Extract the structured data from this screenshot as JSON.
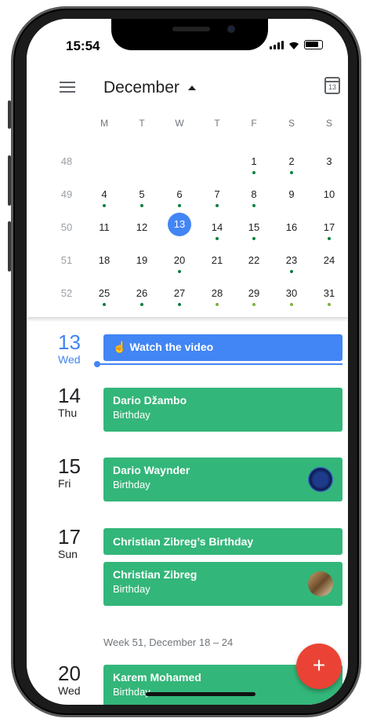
{
  "status": {
    "time": "15:54"
  },
  "header": {
    "month": "December",
    "cal_icon_day": "13"
  },
  "calendar": {
    "dow": [
      "M",
      "T",
      "W",
      "T",
      "F",
      "S",
      "S"
    ],
    "weeks": [
      {
        "wk": "48",
        "days": [
          "",
          "",
          "",
          "",
          "1",
          "2",
          "3"
        ],
        "dots": [
          "",
          "",
          "",
          "",
          "teal",
          "teal",
          ""
        ]
      },
      {
        "wk": "49",
        "days": [
          "4",
          "5",
          "6",
          "7",
          "8",
          "9",
          "10"
        ],
        "dots": [
          "teal",
          "teal",
          "teal",
          "teal",
          "teal",
          "",
          ""
        ]
      },
      {
        "wk": "50",
        "days": [
          "11",
          "12",
          "13",
          "14",
          "15",
          "16",
          "17"
        ],
        "dots": [
          "",
          "",
          "",
          "teal",
          "teal",
          "",
          "teal"
        ]
      },
      {
        "wk": "51",
        "days": [
          "18",
          "19",
          "20",
          "21",
          "22",
          "23",
          "24"
        ],
        "dots": [
          "",
          "",
          "teal",
          "",
          "",
          "teal",
          ""
        ]
      },
      {
        "wk": "52",
        "days": [
          "25",
          "26",
          "27",
          "28",
          "29",
          "30",
          "31"
        ],
        "dots": [
          "teal",
          "teal",
          "teal",
          "green",
          "green",
          "green",
          "green"
        ]
      }
    ],
    "today": "13"
  },
  "agenda": {
    "days": [
      {
        "num": "13",
        "name": "Wed"
      },
      {
        "num": "14",
        "name": "Thu"
      },
      {
        "num": "15",
        "name": "Fri"
      },
      {
        "num": "17",
        "name": "Sun"
      },
      {
        "num": "20",
        "name": "Wed"
      }
    ],
    "events": [
      {
        "title": "Watch the video"
      },
      {
        "title": "Dario Džambo",
        "sub": "Birthday"
      },
      {
        "title": "Dario Waynder",
        "sub": "Birthday"
      },
      {
        "title": "Christian Zibreg’s Birthday"
      },
      {
        "title": "Christian Zibreg",
        "sub": "Birthday"
      },
      {
        "title": "Karem Mohamed",
        "sub": "Birthday"
      }
    ],
    "week_header": "Week 51, December 18 – 24"
  },
  "fab": {
    "label": "+"
  },
  "colors": {
    "blue": "#4285f4",
    "green": "#33b679",
    "teal": "#0b8043",
    "lime": "#7cb342",
    "fab": "#ea4335"
  }
}
